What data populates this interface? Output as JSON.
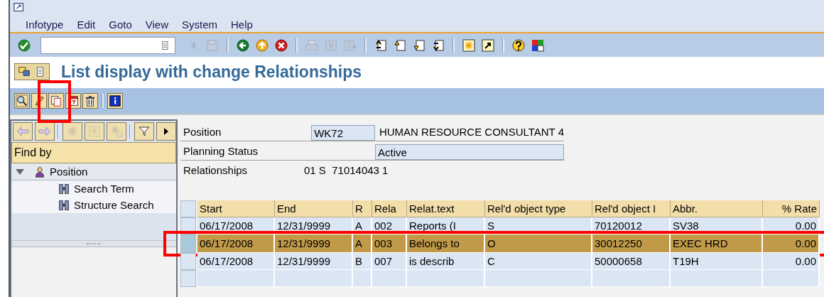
{
  "menu_bar": [
    "Infotype",
    "Edit",
    "Goto",
    "View",
    "System",
    "Help"
  ],
  "system_toolbar": [
    {
      "kind": "enter",
      "disabled": false
    },
    {
      "kind": "command-field"
    },
    {
      "kind": "back-arrow",
      "disabled": true
    },
    {
      "kind": "save",
      "disabled": true
    },
    {
      "kind": "separator"
    },
    {
      "kind": "back",
      "disabled": false
    },
    {
      "kind": "exit",
      "disabled": false
    },
    {
      "kind": "cancel",
      "disabled": false
    },
    {
      "kind": "separator"
    },
    {
      "kind": "print",
      "disabled": true
    },
    {
      "kind": "find",
      "disabled": true
    },
    {
      "kind": "find-next",
      "disabled": true
    },
    {
      "kind": "separator"
    },
    {
      "kind": "first-page",
      "disabled": false
    },
    {
      "kind": "prev-page",
      "disabled": false
    },
    {
      "kind": "next-page",
      "disabled": false
    },
    {
      "kind": "last-page",
      "disabled": false
    },
    {
      "kind": "separator"
    },
    {
      "kind": "new-session",
      "disabled": false
    },
    {
      "kind": "shortcut",
      "disabled": false
    },
    {
      "kind": "separator"
    },
    {
      "kind": "help",
      "disabled": false
    },
    {
      "kind": "layout",
      "disabled": false
    }
  ],
  "title_bar": {
    "title": "List display with change Relationships",
    "buttons": [
      {
        "kind": "hide-tree"
      },
      {
        "kind": "doc"
      }
    ]
  },
  "application_toolbar": [
    {
      "kind": "overview"
    },
    {
      "kind": "pencil"
    },
    {
      "kind": "copy",
      "highlighted": true
    },
    {
      "kind": "delimit"
    },
    {
      "kind": "delete"
    },
    {
      "kind": "separator"
    },
    {
      "kind": "info"
    }
  ],
  "navigator": {
    "toolbar": [
      {
        "kind": "left",
        "disabled": false
      },
      {
        "kind": "right",
        "disabled": false
      },
      {
        "kind": "separator"
      },
      {
        "kind": "star-plus",
        "disabled": true
      },
      {
        "kind": "star",
        "disabled": true
      },
      {
        "kind": "star-copy",
        "disabled": true
      },
      {
        "kind": "separator"
      },
      {
        "kind": "filter",
        "disabled": false
      },
      {
        "kind": "more",
        "disabled": false
      }
    ],
    "header": "Find by",
    "tree": [
      {
        "label": "Position",
        "expanded": true,
        "children": [
          {
            "label": "Search Term"
          },
          {
            "label": "Structure Search"
          }
        ]
      }
    ]
  },
  "form": {
    "position_label": "Position",
    "position_value": "WK72",
    "position_text": "HUMAN RESOURCE CONSULTANT 4",
    "status_label": "Planning Status",
    "status_value": "Active",
    "relationships_label": "Relationships",
    "relationships_value": "01 S  71014043 1"
  },
  "table": {
    "columns": [
      "Start",
      "End",
      "R",
      "Rela",
      "Relat.text",
      "Rel'd object type",
      "Rel'd object I",
      "Abbr.",
      "% Rate"
    ],
    "rows": [
      {
        "cells": [
          "06/17/2008",
          "12/31/9999",
          "A",
          "002",
          "Reports (I",
          "S",
          "70120012",
          "SV38",
          "0.00"
        ],
        "selected": false
      },
      {
        "cells": [
          "06/17/2008",
          "12/31/9999",
          "A",
          "003",
          "Belongs to",
          "O",
          "30012250",
          "EXEC HRD",
          "0.00"
        ],
        "selected": true,
        "highlighted": true
      },
      {
        "cells": [
          "06/17/2008",
          "12/31/9999",
          "B",
          "007",
          "is describ",
          "C",
          "50000658",
          "T19H",
          "0.00"
        ],
        "selected": false
      },
      {
        "cells": [],
        "selected": false
      }
    ]
  }
}
